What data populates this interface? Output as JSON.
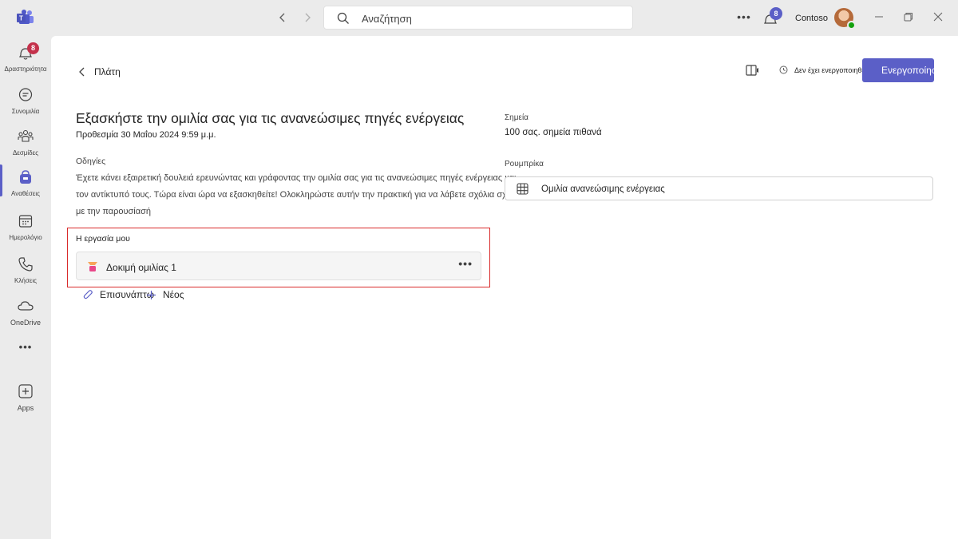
{
  "titlebar": {
    "search_placeholder": "Αναζήτηση",
    "notification_count": "8",
    "tenant": "Contoso"
  },
  "rail": {
    "items": [
      {
        "label": "Δραστηριότητα",
        "icon": "bell-icon",
        "badge": "8"
      },
      {
        "label": "Συνομιλία",
        "icon": "chat-icon"
      },
      {
        "label": "Δεσμίδες",
        "icon": "teams-icon"
      },
      {
        "label": "Αναθέσεις",
        "icon": "assignments-icon",
        "active": true
      },
      {
        "label": "Ημερολόγιο",
        "icon": "calendar-icon"
      },
      {
        "label": "Κλήσεις",
        "icon": "phone-icon"
      },
      {
        "label": "OneDrive",
        "icon": "cloud-icon"
      },
      {
        "label": "Apps",
        "icon": "add-apps-icon"
      }
    ]
  },
  "header": {
    "back_label": "Πλάτη",
    "status": "Δεν έχει ενεργοποιηθεί",
    "activate_label": "Ενεργοποίηση"
  },
  "assignment": {
    "title": "Εξασκήστε την ομιλία σας για τις ανανεώσιμες πηγές ενέργειας",
    "due": "Προθεσμία 30 Μαΐου 2024 9:59 μ.μ.",
    "instructions_label": "Οδηγίες",
    "instructions": "Έχετε κάνει εξαιρετική δουλειά ερευνώντας και γράφοντας την ομιλία σας για τις ανανεώσιμες πηγές ενέργειας και τον αντίκτυπό τους. Τώρα είναι ώρα να εξασκηθείτε! Ολοκληρώστε αυτήν την πρακτική για να λάβετε σχόλια σχετικά με την παρουσίασή"
  },
  "my_work": {
    "label": "Η εργασία μου",
    "file_name": "Δοκιμή ομιλίας 1",
    "attach_label": "Επισυνάπτω",
    "new_label": "Νέος"
  },
  "points": {
    "label": "Σημεία",
    "value": "100 σας. σημεία πιθανά"
  },
  "rubric": {
    "label": "Ρουμπρίκα",
    "name": "Ομιλία ανανεώσιμης ενέργειας"
  },
  "colors": {
    "accent": "#5b5fc7",
    "highlight": "#d92b2b",
    "badge_red": "#c4314b"
  }
}
